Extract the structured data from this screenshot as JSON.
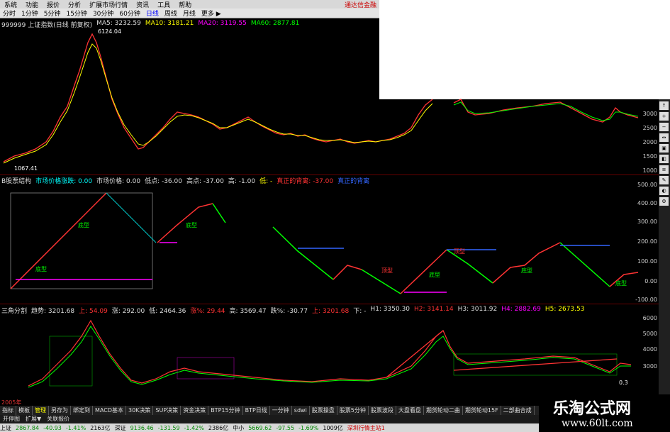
{
  "menu": [
    "系统",
    "功能",
    "报价",
    "分析",
    "扩展市场行情",
    "资讯",
    "工具",
    "帮助"
  ],
  "brand": "通达信金融",
  "periods": [
    "分时",
    "1分钟",
    "5分钟",
    "15分钟",
    "30分钟",
    "60分钟",
    "日线",
    "周线",
    "月线",
    "更多 ▶"
  ],
  "period_selected": 6,
  "panel1": {
    "title": "999999 上证指数(日线 前复权)",
    "ma5": "MA5: 3232.59",
    "ma10": "MA10: 3181.21",
    "ma20": "MA20: 3119.55",
    "ma60": "MA60: 2877.81",
    "peak_label": "6124.04",
    "low_label": "1067.41",
    "axis": [
      "3000",
      "2500",
      "2000",
      "1500",
      "1000"
    ]
  },
  "panel2": {
    "title": "B股票结构",
    "items": [
      "市场价格涨跌: 0.00",
      "市场价格: 0.00",
      "低点: -36.00",
      "高点: -37.00",
      "高: -1.00",
      "低: -",
      "真正的背离: -37.00",
      "真正的背离"
    ],
    "label_a": "底型",
    "label_b": "顶型",
    "axis": [
      "500.00",
      "400.00",
      "300.00",
      "200.00",
      "100.00",
      "0.00",
      "-100.00"
    ]
  },
  "panel3": {
    "title": "三角分割",
    "items": [
      "趋势: 3201.68",
      "上: 54.09",
      "涨: 292.00",
      "低: 2464.36",
      "涨%: 29.44",
      "高: 3569.47",
      "跌%: -30.77",
      "上: 3201.68",
      "下: -"
    ],
    "h_items": [
      "H1: 3350.30",
      "H2: 3141.14",
      "H3: 3011.92",
      "H4: 2882.69",
      "H5: 2673.53"
    ],
    "axis": [
      "6000",
      "5000",
      "4000",
      "3000"
    ],
    "readout": "0.3"
  },
  "year_label": "2005年",
  "bottom_tabs": [
    "指标",
    "模板",
    "管理",
    "另存为",
    "绑定到",
    "MACD基本",
    "30K决策",
    "SUP决策",
    "资金决策",
    "BTP15分钟",
    "BTP日线",
    "一分钟",
    "sdwi",
    "股票操盘",
    "股票5分钟",
    "股票波段",
    "大盘看盘",
    "期货轮动二曲",
    "期货轮动15F",
    "二部曲合成"
  ],
  "mode_tabs": [
    "开停图",
    "扩展▼",
    "关联报价"
  ],
  "status": {
    "sh": "上证",
    "sh_val": "2867.84",
    "sh_chg": "-40.93",
    "sh_pct": "-1.41%",
    "sh_amt": "2163亿",
    "sz": "深证",
    "sz_val": "9136.46",
    "sz_chg": "-131.59",
    "sz_pct": "-1.42%",
    "sz_amt": "2386亿",
    "zx": "中小",
    "zx_val": "5669.62",
    "zx_chg": "-97.55",
    "zx_pct": "-1.69%",
    "zx_amt": "1009亿",
    "site": "深圳行情主站1"
  },
  "watermark": {
    "title": "乐淘公式网",
    "url": "www.60lt.com"
  },
  "colors": {
    "up": "#ff3333",
    "down": "#00ff00",
    "ma20": "#ff00ff",
    "blue": "#3366ff"
  }
}
